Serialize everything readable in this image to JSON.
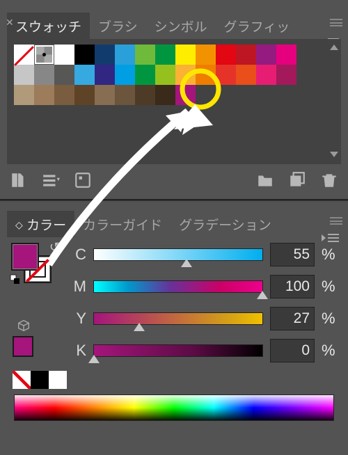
{
  "topbar": {
    "tabs": [
      "スウォッチ",
      "ブラシ",
      "シンボル",
      "グラフィッ"
    ]
  },
  "swatches": {
    "rows": [
      [
        "none",
        "reg",
        "#ffffff",
        "#000000",
        "#123b6d",
        "#2aa0da",
        "#6fba3a",
        "#009640",
        "#ffed00",
        "#f39200",
        "#e30613",
        "#be1622",
        "#951b81",
        "#e6007e"
      ],
      [
        "#c6c6c6",
        "#878787",
        "#575756",
        "#36a9e1",
        "#312783",
        "#009fe3",
        "#009640",
        "#95c11f",
        "#f9b233",
        "#ef7d00",
        "#e6332a",
        "#e94e1b",
        "#e71d73",
        "#a3195b"
      ],
      [
        "#b09a7a",
        "#9c7c5b",
        "#7a5c3e",
        "#5e4326",
        "#876d52",
        "#6b553c",
        "#4e3b27",
        "#3a2a1a",
        "#a5157c"
      ]
    ]
  },
  "colorPanel": {
    "tabs": [
      "カラー",
      "カラーガイド",
      "グラデーション"
    ],
    "channels": [
      {
        "label": "C",
        "value": 55,
        "gradient": "linear-gradient(to right,#ffffff,#00aeef)"
      },
      {
        "label": "M",
        "value": 100,
        "gradient": "linear-gradient(to right,#00ffff,#0099cc 20%,#663399 45%,#cc0066 75%,#ec008c)"
      },
      {
        "label": "Y",
        "value": 27,
        "gradient": "linear-gradient(to right,#a5157c,#d4a017 80%,#f0c000)"
      },
      {
        "label": "K",
        "value": 0,
        "gradient": "linear-gradient(to right,#a5157c,#5a0b44 60%,#000000)"
      }
    ],
    "fillColor": "#a5157c"
  }
}
